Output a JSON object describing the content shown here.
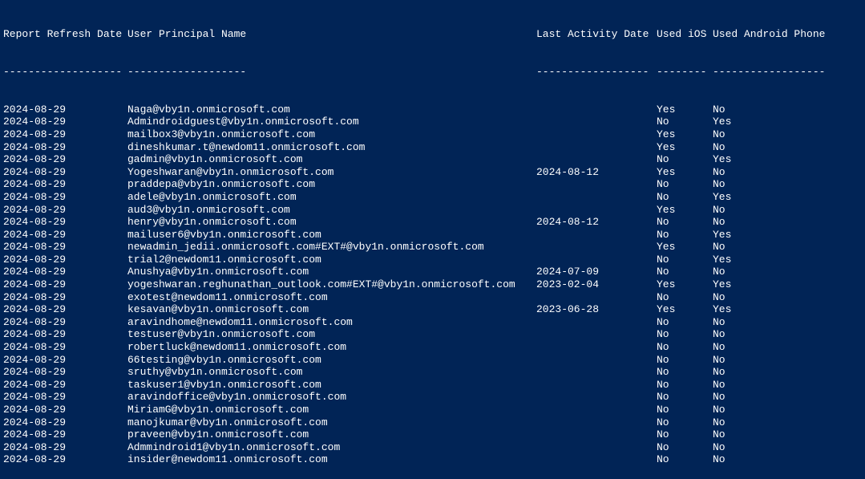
{
  "headers": {
    "refresh_date": "Report Refresh Date",
    "upn": "User Principal Name",
    "last_activity": "Last Activity Date",
    "used_ios": "Used iOS",
    "used_android": "Used Android Phone"
  },
  "separators": {
    "refresh_date": "-------------------",
    "upn": "-------------------",
    "last_activity": "------------------",
    "used_ios": "--------",
    "used_android": "------------------"
  },
  "rows": [
    {
      "refresh_date": "2024-08-29",
      "upn": "Naga@vby1n.onmicrosoft.com",
      "last_activity": "",
      "used_ios": "Yes",
      "used_android": "No"
    },
    {
      "refresh_date": "2024-08-29",
      "upn": "Admindroidguest@vby1n.onmicrosoft.com",
      "last_activity": "",
      "used_ios": "No",
      "used_android": "Yes"
    },
    {
      "refresh_date": "2024-08-29",
      "upn": "mailbox3@vby1n.onmicrosoft.com",
      "last_activity": "",
      "used_ios": "Yes",
      "used_android": "No"
    },
    {
      "refresh_date": "2024-08-29",
      "upn": "dineshkumar.t@newdom11.onmicrosoft.com",
      "last_activity": "",
      "used_ios": "Yes",
      "used_android": "No"
    },
    {
      "refresh_date": "2024-08-29",
      "upn": "gadmin@vby1n.onmicrosoft.com",
      "last_activity": "",
      "used_ios": "No",
      "used_android": "Yes"
    },
    {
      "refresh_date": "2024-08-29",
      "upn": "Yogeshwaran@vby1n.onmicrosoft.com",
      "last_activity": "2024-08-12",
      "used_ios": "Yes",
      "used_android": "No"
    },
    {
      "refresh_date": "2024-08-29",
      "upn": "praddepa@vby1n.onmicrosoft.com",
      "last_activity": "",
      "used_ios": "No",
      "used_android": "No"
    },
    {
      "refresh_date": "2024-08-29",
      "upn": "adele@vby1n.onmicrosoft.com",
      "last_activity": "",
      "used_ios": "No",
      "used_android": "Yes"
    },
    {
      "refresh_date": "2024-08-29",
      "upn": "aud3@vby1n.onmicrosoft.com",
      "last_activity": "",
      "used_ios": "Yes",
      "used_android": "No"
    },
    {
      "refresh_date": "2024-08-29",
      "upn": "henry@vby1n.onmicrosoft.com",
      "last_activity": "2024-08-12",
      "used_ios": "No",
      "used_android": "No"
    },
    {
      "refresh_date": "2024-08-29",
      "upn": "mailuser6@vby1n.onmicrosoft.com",
      "last_activity": "",
      "used_ios": "No",
      "used_android": "Yes"
    },
    {
      "refresh_date": "2024-08-29",
      "upn": "newadmin_jedii.onmicrosoft.com#EXT#@vby1n.onmicrosoft.com",
      "last_activity": "",
      "used_ios": "Yes",
      "used_android": "No"
    },
    {
      "refresh_date": "2024-08-29",
      "upn": "trial2@newdom11.onmicrosoft.com",
      "last_activity": "",
      "used_ios": "No",
      "used_android": "Yes"
    },
    {
      "refresh_date": "2024-08-29",
      "upn": "Anushya@vby1n.onmicrosoft.com",
      "last_activity": "2024-07-09",
      "used_ios": "No",
      "used_android": "No"
    },
    {
      "refresh_date": "2024-08-29",
      "upn": "yogeshwaran.reghunathan_outlook.com#EXT#@vby1n.onmicrosoft.com",
      "last_activity": "2023-02-04",
      "used_ios": "Yes",
      "used_android": "Yes"
    },
    {
      "refresh_date": "2024-08-29",
      "upn": "exotest@newdom11.onmicrosoft.com",
      "last_activity": "",
      "used_ios": "No",
      "used_android": "No"
    },
    {
      "refresh_date": "2024-08-29",
      "upn": "kesavan@vby1n.onmicrosoft.com",
      "last_activity": "2023-06-28",
      "used_ios": "Yes",
      "used_android": "Yes"
    },
    {
      "refresh_date": "2024-08-29",
      "upn": "aravindhome@newdom11.onmicrosoft.com",
      "last_activity": "",
      "used_ios": "No",
      "used_android": "No"
    },
    {
      "refresh_date": "2024-08-29",
      "upn": "testuser@vby1n.onmicrosoft.com",
      "last_activity": "",
      "used_ios": "No",
      "used_android": "No"
    },
    {
      "refresh_date": "2024-08-29",
      "upn": "robertluck@newdom11.onmicrosoft.com",
      "last_activity": "",
      "used_ios": "No",
      "used_android": "No"
    },
    {
      "refresh_date": "2024-08-29",
      "upn": "66testing@vby1n.onmicrosoft.com",
      "last_activity": "",
      "used_ios": "No",
      "used_android": "No"
    },
    {
      "refresh_date": "2024-08-29",
      "upn": "sruthy@vby1n.onmicrosoft.com",
      "last_activity": "",
      "used_ios": "No",
      "used_android": "No"
    },
    {
      "refresh_date": "2024-08-29",
      "upn": "taskuser1@vby1n.onmicrosoft.com",
      "last_activity": "",
      "used_ios": "No",
      "used_android": "No"
    },
    {
      "refresh_date": "2024-08-29",
      "upn": "aravindoffice@vby1n.onmicrosoft.com",
      "last_activity": "",
      "used_ios": "No",
      "used_android": "No"
    },
    {
      "refresh_date": "2024-08-29",
      "upn": "MiriamG@vby1n.onmicrosoft.com",
      "last_activity": "",
      "used_ios": "No",
      "used_android": "No"
    },
    {
      "refresh_date": "2024-08-29",
      "upn": "manojkumar@vby1n.onmicrosoft.com",
      "last_activity": "",
      "used_ios": "No",
      "used_android": "No"
    },
    {
      "refresh_date": "2024-08-29",
      "upn": "praveen@vby1n.onmicrosoft.com",
      "last_activity": "",
      "used_ios": "No",
      "used_android": "No"
    },
    {
      "refresh_date": "2024-08-29",
      "upn": "Admmindroid1@vby1n.onmicrosoft.com",
      "last_activity": "",
      "used_ios": "No",
      "used_android": "No"
    },
    {
      "refresh_date": "2024-08-29",
      "upn": "insider@newdom11.onmicrosoft.com",
      "last_activity": "",
      "used_ios": "No",
      "used_android": "No"
    }
  ]
}
